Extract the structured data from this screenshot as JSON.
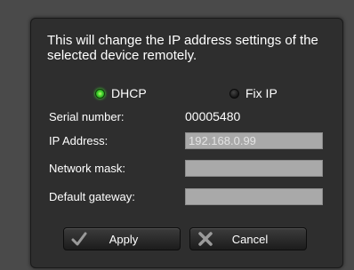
{
  "dialog": {
    "message": "This will change the IP address settings of the selected device remotely."
  },
  "mode": {
    "dhcp_label": "DHCP",
    "fixip_label": "Fix IP",
    "selected": "DHCP"
  },
  "fields": {
    "serial_label": "Serial number:",
    "serial_value": "00005480",
    "ip_label": "IP Address:",
    "ip_value": "192.168.0.99",
    "mask_label": "Network mask:",
    "mask_value": "",
    "gateway_label": "Default gateway:",
    "gateway_value": ""
  },
  "buttons": {
    "apply_label": "Apply",
    "cancel_label": "Cancel"
  },
  "colors": {
    "dialog_bg": "#2e2e2e",
    "field_bg": "#a9a9a9",
    "radio_on": "#3fd12e"
  },
  "icons": {
    "apply": "checkmark-icon",
    "cancel": "x-icon"
  }
}
